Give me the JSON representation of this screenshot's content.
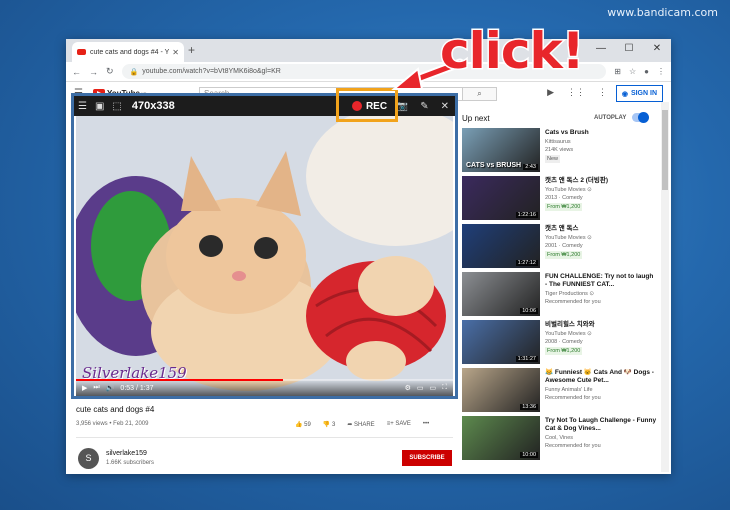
{
  "watermark": "www.bandicam.com",
  "annotation": {
    "text": "click!",
    "color": "#e8262b"
  },
  "browser": {
    "tab_title": "cute cats and dogs #4 - YouTu...",
    "new_tab": "+",
    "url": "youtube.com/watch?v=bVt8YMK6i8o&gl=KR",
    "window_controls": [
      "—",
      "☐",
      "✕"
    ]
  },
  "youtube": {
    "logo": "YouTube",
    "logo_region": "KR",
    "search_placeholder": "Search",
    "sign_in": "SIGN IN"
  },
  "bandicam": {
    "size": "470x338",
    "rec_label": "REC",
    "highlight_color": "#f2a31b"
  },
  "video": {
    "watermark": "Silverlake159",
    "time": "0:53 / 1:37",
    "progress_fraction": 0.55,
    "title": "cute cats and dogs #4",
    "meta": "3,956 views • Feb 21, 2009",
    "likes": "59",
    "dislikes": "3",
    "share": "SHARE",
    "save": "SAVE",
    "more": "•••",
    "channel_initial": "S",
    "channel_name": "silverlake159",
    "subscribers": "1.66K subscribers",
    "subscribe": "SUBSCRIBE"
  },
  "sidebar": {
    "up_next": "Up next",
    "autoplay": "AUTOPLAY",
    "items": [
      {
        "title": "Cats vs Brush",
        "line1": "Kittisaurus",
        "line2": "214K views",
        "badge": "New",
        "duration": "2:43",
        "caption": "CATS vs BRUSH",
        "thumb_color": "#7a9fb6"
      },
      {
        "title": "캣츠 앤 독스 2 (더빙판)",
        "line1": "YouTube Movies ⊙",
        "line2": "2013 · Comedy",
        "badge": "From ₩1,200",
        "duration": "1:22:16",
        "caption": "",
        "thumb_color": "#3b2a5e"
      },
      {
        "title": "캣츠 앤 독스",
        "line1": "YouTube Movies ⊙",
        "line2": "2001 · Comedy",
        "badge": "From ₩1,200",
        "duration": "1:27:12",
        "caption": "",
        "thumb_color": "#1f3f7a"
      },
      {
        "title": "FUN CHALLENGE: Try not to laugh - The FUNNIEST CAT...",
        "line1": "Tiger Productions ⊙",
        "line2": "Recommended for you",
        "badge": "",
        "duration": "10:06",
        "caption": "",
        "thumb_color": "#8c8f93"
      },
      {
        "title": "비벌리힐스 치와와",
        "line1": "YouTube Movies ⊙",
        "line2": "2008 · Comedy",
        "badge": "From ₩1,200",
        "duration": "1:31:27",
        "caption": "",
        "thumb_color": "#4a6fa8"
      },
      {
        "title": "😹 Funniest 🐱 Cats And 🐶 Dogs - Awesome Cute Pet...",
        "line1": "Funny Animals' Life",
        "line2": "Recommended for you",
        "badge": "",
        "duration": "13:36",
        "caption": "",
        "thumb_color": "#b9a68a"
      },
      {
        "title": "Try Not To Laugh Challenge - Funny Cat & Dog Vines...",
        "line1": "Cool, Vines",
        "line2": "Recommended for you",
        "badge": "",
        "duration": "10:00",
        "caption": "",
        "thumb_color": "#5d8a4e"
      }
    ]
  }
}
